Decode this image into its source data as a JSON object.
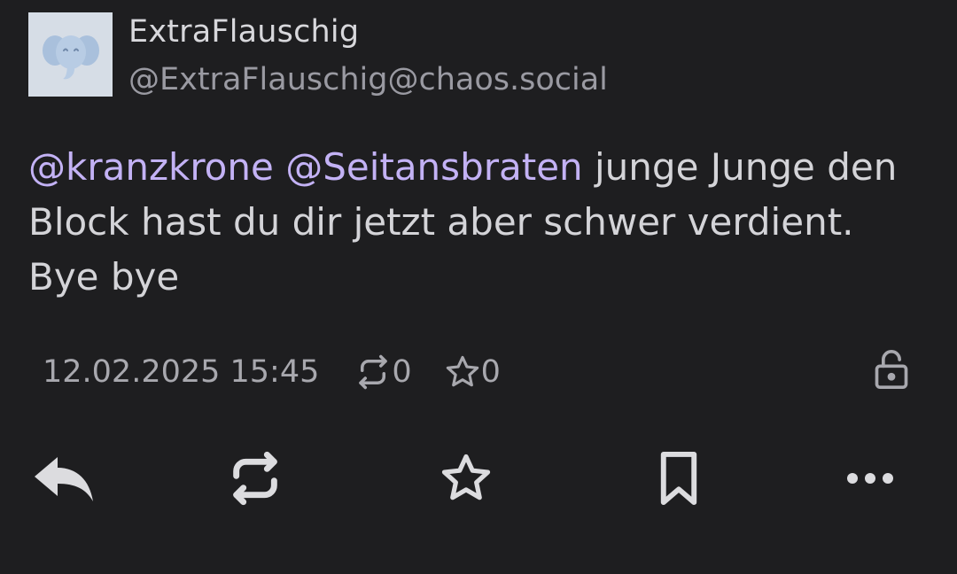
{
  "author": {
    "display_name": "ExtraFlauschig",
    "handle": "@ExtraFlauschig@chaos.social",
    "avatar_icon": "elephant-avatar-icon"
  },
  "post": {
    "mentions": [
      "@kranzkrone",
      "@Seitansbraten"
    ],
    "text": "junge Junge den Block hast du dir jetzt aber schwer verdient. Bye bye",
    "timestamp": "12.02.2025 15:45",
    "boost_count": "0",
    "favourite_count": "0",
    "visibility_icon": "lock-open-icon"
  },
  "actions": [
    {
      "name": "reply-button",
      "icon": "reply-icon"
    },
    {
      "name": "boost-button",
      "icon": "repeat-icon"
    },
    {
      "name": "favourite-button",
      "icon": "star-icon"
    },
    {
      "name": "bookmark-button",
      "icon": "bookmark-icon"
    },
    {
      "name": "more-button",
      "icon": "more-horizontal-icon"
    }
  ],
  "colors": {
    "background": "#1e1e20",
    "mention": "#c3b2f5",
    "text": "#d4d4d8",
    "muted": "#a8a8ae",
    "icon": "#dcdcdf"
  }
}
